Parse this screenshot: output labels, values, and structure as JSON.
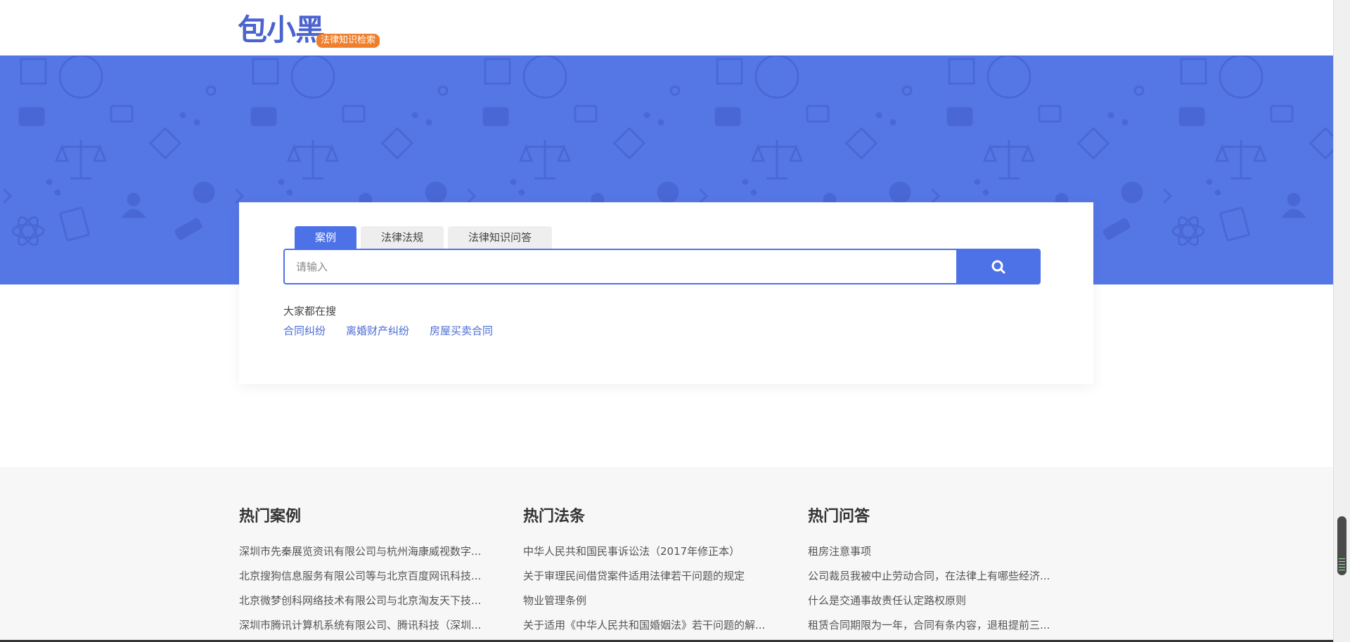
{
  "header": {
    "logo_text": "包小黑",
    "logo_badge": "法律知识检索"
  },
  "colors": {
    "brand_blue": "#4d72e8",
    "banner_blue": "#5577e6",
    "badge_orange": "#f07f2c",
    "link_blue": "#4a6bd6"
  },
  "search": {
    "tabs": [
      {
        "label": "案例",
        "active": true
      },
      {
        "label": "法律法规",
        "active": false
      },
      {
        "label": "法律知识问答",
        "active": false
      }
    ],
    "placeholder": "请输入",
    "button_icon": "search-icon",
    "hot_title": "大家都在搜",
    "hot_links": [
      "合同纠纷",
      "离婚财产纠纷",
      "房屋买卖合同"
    ]
  },
  "hot_cases": {
    "title": "热门案例",
    "items": [
      "深圳市先秦展览资讯有限公司与杭州海康威视数字...",
      "北京搜狗信息服务有限公司等与北京百度网讯科技...",
      "北京微梦创科网络技术有限公司与北京淘友天下技...",
      "深圳市腾讯计算机系统有限公司、腾讯科技（深圳..."
    ]
  },
  "hot_laws": {
    "title": "热门法条",
    "items": [
      "中华人民共和国民事诉讼法（2017年修正本）",
      "关于审理民间借贷案件适用法律若干问题的规定",
      "物业管理条例",
      "关于适用《中华人民共和国婚姻法》若干问题的解..."
    ]
  },
  "hot_qa": {
    "title": "热门问答",
    "items": [
      "租房注意事项",
      "公司裁员我被中止劳动合同，在法律上有哪些经济...",
      "什么是交通事故责任认定路权原则",
      "租赁合同期限为一年，合同有条内容，退租提前三..."
    ]
  }
}
